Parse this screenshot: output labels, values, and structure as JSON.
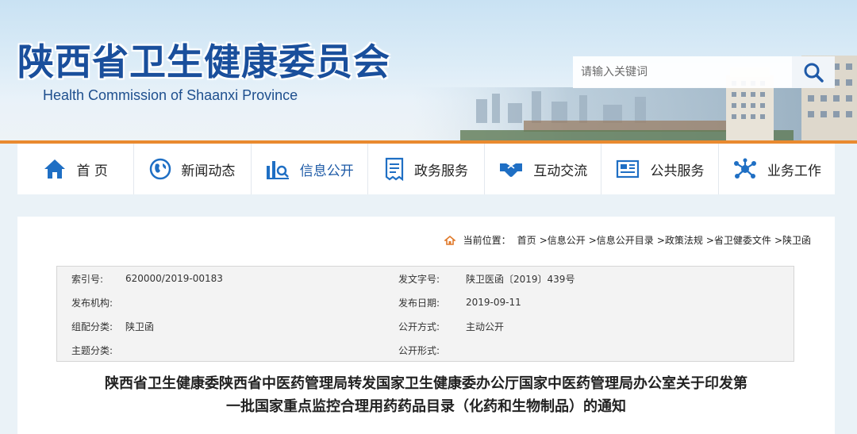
{
  "header": {
    "title_cn": "陕西省卫生健康委员会",
    "title_en": "Health Commission of Shaanxi Province",
    "search_placeholder": "请输入关键词"
  },
  "nav": {
    "items": [
      {
        "label": "首 页",
        "icon": "home-icon"
      },
      {
        "label": "新闻动态",
        "icon": "globe-icon"
      },
      {
        "label": "信息公开",
        "icon": "bar-chart-search-icon",
        "active": true
      },
      {
        "label": "政务服务",
        "icon": "document-icon"
      },
      {
        "label": "互动交流",
        "icon": "handshake-icon"
      },
      {
        "label": "公共服务",
        "icon": "newspaper-icon"
      },
      {
        "label": "业务工作",
        "icon": "network-icon"
      }
    ]
  },
  "breadcrumb": {
    "prefix": "当前位置：",
    "items": [
      "首页",
      ">信息公开",
      ">信息公开目录",
      ">政策法规",
      ">省卫健委文件",
      ">陕卫函"
    ]
  },
  "meta": {
    "rows": [
      {
        "k1": "索引号:",
        "v1": "620000/2019-00183",
        "k2": "发文字号:",
        "v2": "陕卫医函〔2019〕439号"
      },
      {
        "k1": "发布机构:",
        "v1": "",
        "k2": "发布日期:",
        "v2": "2019-09-11"
      },
      {
        "k1": "组配分类:",
        "v1": "陕卫函",
        "k2": "公开方式:",
        "v2": "主动公开"
      },
      {
        "k1": "主题分类:",
        "v1": "",
        "k2": "公开形式:",
        "v2": ""
      }
    ]
  },
  "document": {
    "title_line1": "陕西省卫生健康委陕西省中医药管理局转发国家卫生健康委办公厅国家中医药管理局办公室关于印发第",
    "title_line2": "一批国家重点监控合理用药药品目录（化药和生物制品）的通知"
  },
  "colors": {
    "brand_blue": "#1a4f9c",
    "accent_orange": "#e98a2f",
    "nav_active": "#1d5aa6"
  }
}
